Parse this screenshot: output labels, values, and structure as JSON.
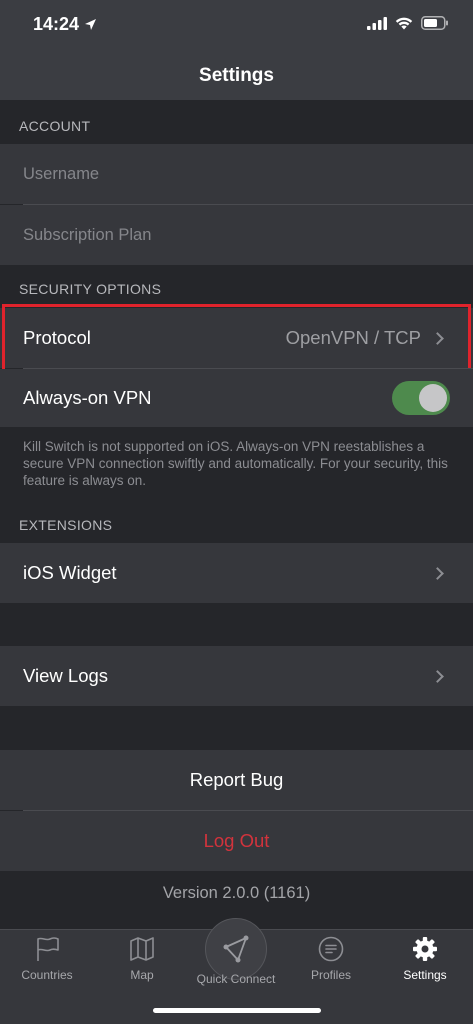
{
  "status_bar": {
    "time": "14:24"
  },
  "nav": {
    "title": "Settings"
  },
  "account": {
    "header": "ACCOUNT",
    "username_placeholder": "Username",
    "subscription_placeholder": "Subscription Plan"
  },
  "security": {
    "header": "SECURITY OPTIONS",
    "protocol_label": "Protocol",
    "protocol_value": "OpenVPN / TCP",
    "always_on_label": "Always-on VPN",
    "always_on_enabled": true,
    "note": "Kill Switch is not supported on iOS. Always-on VPN reestablishes a secure VPN connection swiftly and automatically. For your security, this feature is always on."
  },
  "extensions": {
    "header": "EXTENSIONS",
    "widget_label": "iOS Widget"
  },
  "logs": {
    "label": "View Logs"
  },
  "actions": {
    "report_bug": "Report Bug",
    "log_out": "Log Out"
  },
  "version": "Version 2.0.0 (1161)",
  "tabs": [
    {
      "label": "Countries",
      "icon": "flag-icon"
    },
    {
      "label": "Map",
      "icon": "map-icon"
    },
    {
      "label": "Quick Connect",
      "icon": "quick-connect-icon"
    },
    {
      "label": "Profiles",
      "icon": "profiles-icon"
    },
    {
      "label": "Settings",
      "icon": "gear-icon"
    }
  ],
  "colors": {
    "background": "#25262a",
    "cell": "#36373c",
    "toggle_on": "#4e8a4d",
    "destructive": "#d2333c",
    "highlight": "#e0232c"
  }
}
